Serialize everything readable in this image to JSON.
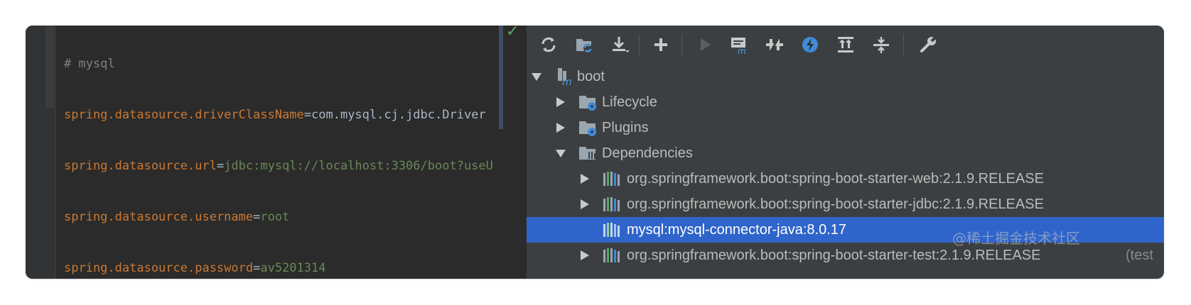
{
  "editor": {
    "lines": [
      {
        "comment": "# mysql"
      },
      {
        "key": "spring.datasource.driverClassName",
        "eq": "=",
        "value": "com.mysql.cj.jdbc.Driver"
      },
      {
        "key": "spring.datasource.url",
        "eq": "=",
        "value": "jdbc:mysql://localhost:3306/boot?useU"
      },
      {
        "key": "spring.datasource.username",
        "eq": "=",
        "value": "root"
      },
      {
        "key": "spring.datasource.password",
        "eq": "=",
        "value": "av5201314"
      }
    ],
    "status_icon": "check-icon"
  },
  "maven": {
    "toolbar": [
      {
        "name": "reload-icon"
      },
      {
        "name": "generate-sources-icon"
      },
      {
        "name": "download-icon"
      },
      {
        "name": "add-icon"
      },
      {
        "name": "run-icon"
      },
      {
        "name": "execute-goal-icon"
      },
      {
        "name": "skip-tests-icon"
      },
      {
        "name": "offline-icon"
      },
      {
        "name": "show-dependencies-icon"
      },
      {
        "name": "collapse-all-icon"
      },
      {
        "name": "settings-wrench-icon"
      }
    ],
    "tree": {
      "root": {
        "label": "boot",
        "icon": "maven-module-icon",
        "expanded": true
      },
      "lifecycle": {
        "label": "Lifecycle",
        "icon": "folder-gear-icon",
        "expanded": false
      },
      "plugins": {
        "label": "Plugins",
        "icon": "folder-gear-icon",
        "expanded": false
      },
      "dependencies": {
        "label": "Dependencies",
        "icon": "folder-library-icon",
        "expanded": true,
        "items": [
          {
            "label": "org.springframework.boot:spring-boot-starter-web:2.1.9.RELEASE",
            "expandable": true,
            "selected": false
          },
          {
            "label": "org.springframework.boot:spring-boot-starter-jdbc:2.1.9.RELEASE",
            "expandable": true,
            "selected": false
          },
          {
            "label": "mysql:mysql-connector-java:8.0.17",
            "expandable": false,
            "selected": true
          },
          {
            "label": "org.springframework.boot:spring-boot-starter-test:2.1.9.RELEASE",
            "suffix": "(test",
            "expandable": true,
            "selected": false
          }
        ]
      }
    }
  },
  "watermark": "@稀土掘金技术社区",
  "colors": {
    "editor_bg": "#2b2b2b",
    "panel_bg": "#3c3f41",
    "selection": "#2f65ca",
    "key": "#cc7832",
    "value": "#6a8759",
    "comment": "#808080"
  }
}
